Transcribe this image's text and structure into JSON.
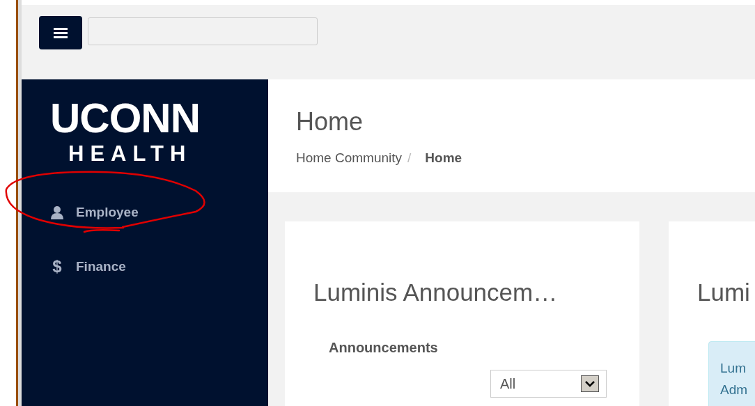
{
  "logo": {
    "line1": "UCONN",
    "line2": "HEALTH"
  },
  "sidebar": {
    "items": [
      {
        "label": "Employee",
        "kind": "person",
        "circled": true
      },
      {
        "label": "Finance",
        "kind": "glyph",
        "glyph": "$",
        "circled": false
      }
    ]
  },
  "page": {
    "title": "Home",
    "breadcrumb": [
      "Home Community",
      "Home"
    ],
    "separator": "/"
  },
  "cards": [
    {
      "title": "Luminis Announcem…",
      "kind": "announcements",
      "section": "Announcements",
      "filter": "All"
    },
    {
      "title": "Lumi",
      "kind": "info",
      "lines": [
        "Lum",
        "Adm"
      ]
    }
  ]
}
